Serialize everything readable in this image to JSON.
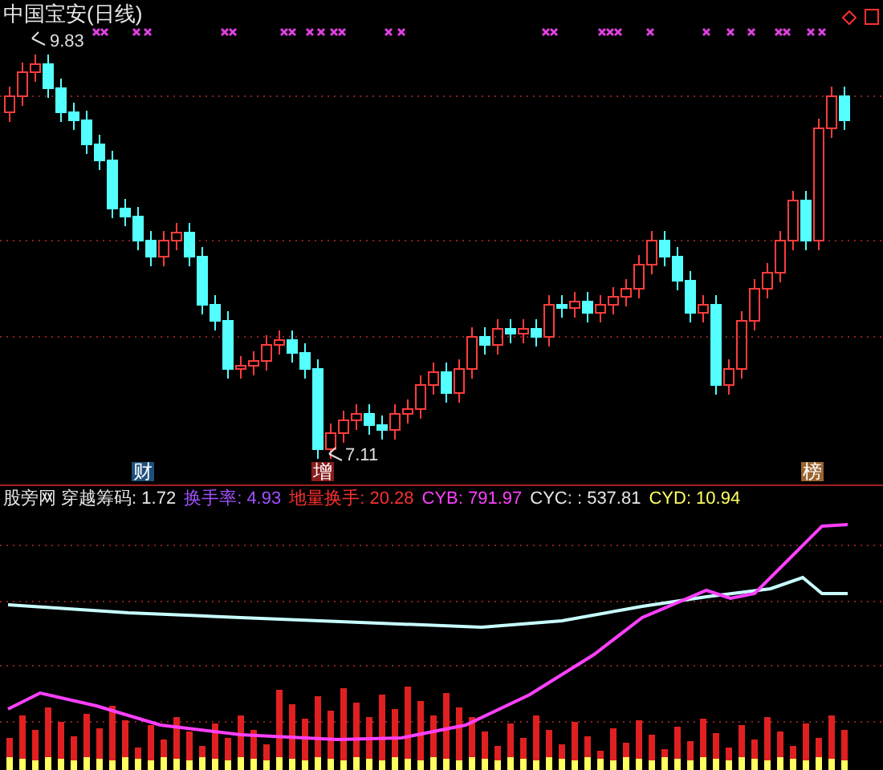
{
  "chart": {
    "title": "中国宝安(日线)",
    "high_label": "9.83",
    "low_label": "7.11",
    "markers": [
      {
        "text": "财",
        "color": "#1e4f7a"
      },
      {
        "text": "增",
        "color": "#8a1c1c"
      },
      {
        "text": "榜",
        "color": "#9a6430"
      }
    ]
  },
  "indicator": {
    "items": [
      {
        "label": "股旁网 穿越筹码: 1.72",
        "color": "#e8e8e8"
      },
      {
        "label": "换手率:  4.93",
        "color": "#a050ff"
      },
      {
        "label": "地量换手: 20.28",
        "color": "#ff3030"
      },
      {
        "label": "CYB: 791.97",
        "color": "#ff40ff"
      },
      {
        "label": "CYC: : 537.81",
        "color": "#e8e8e8"
      },
      {
        "label": "CYD: 10.94",
        "color": "#ffff60"
      }
    ]
  }
}
